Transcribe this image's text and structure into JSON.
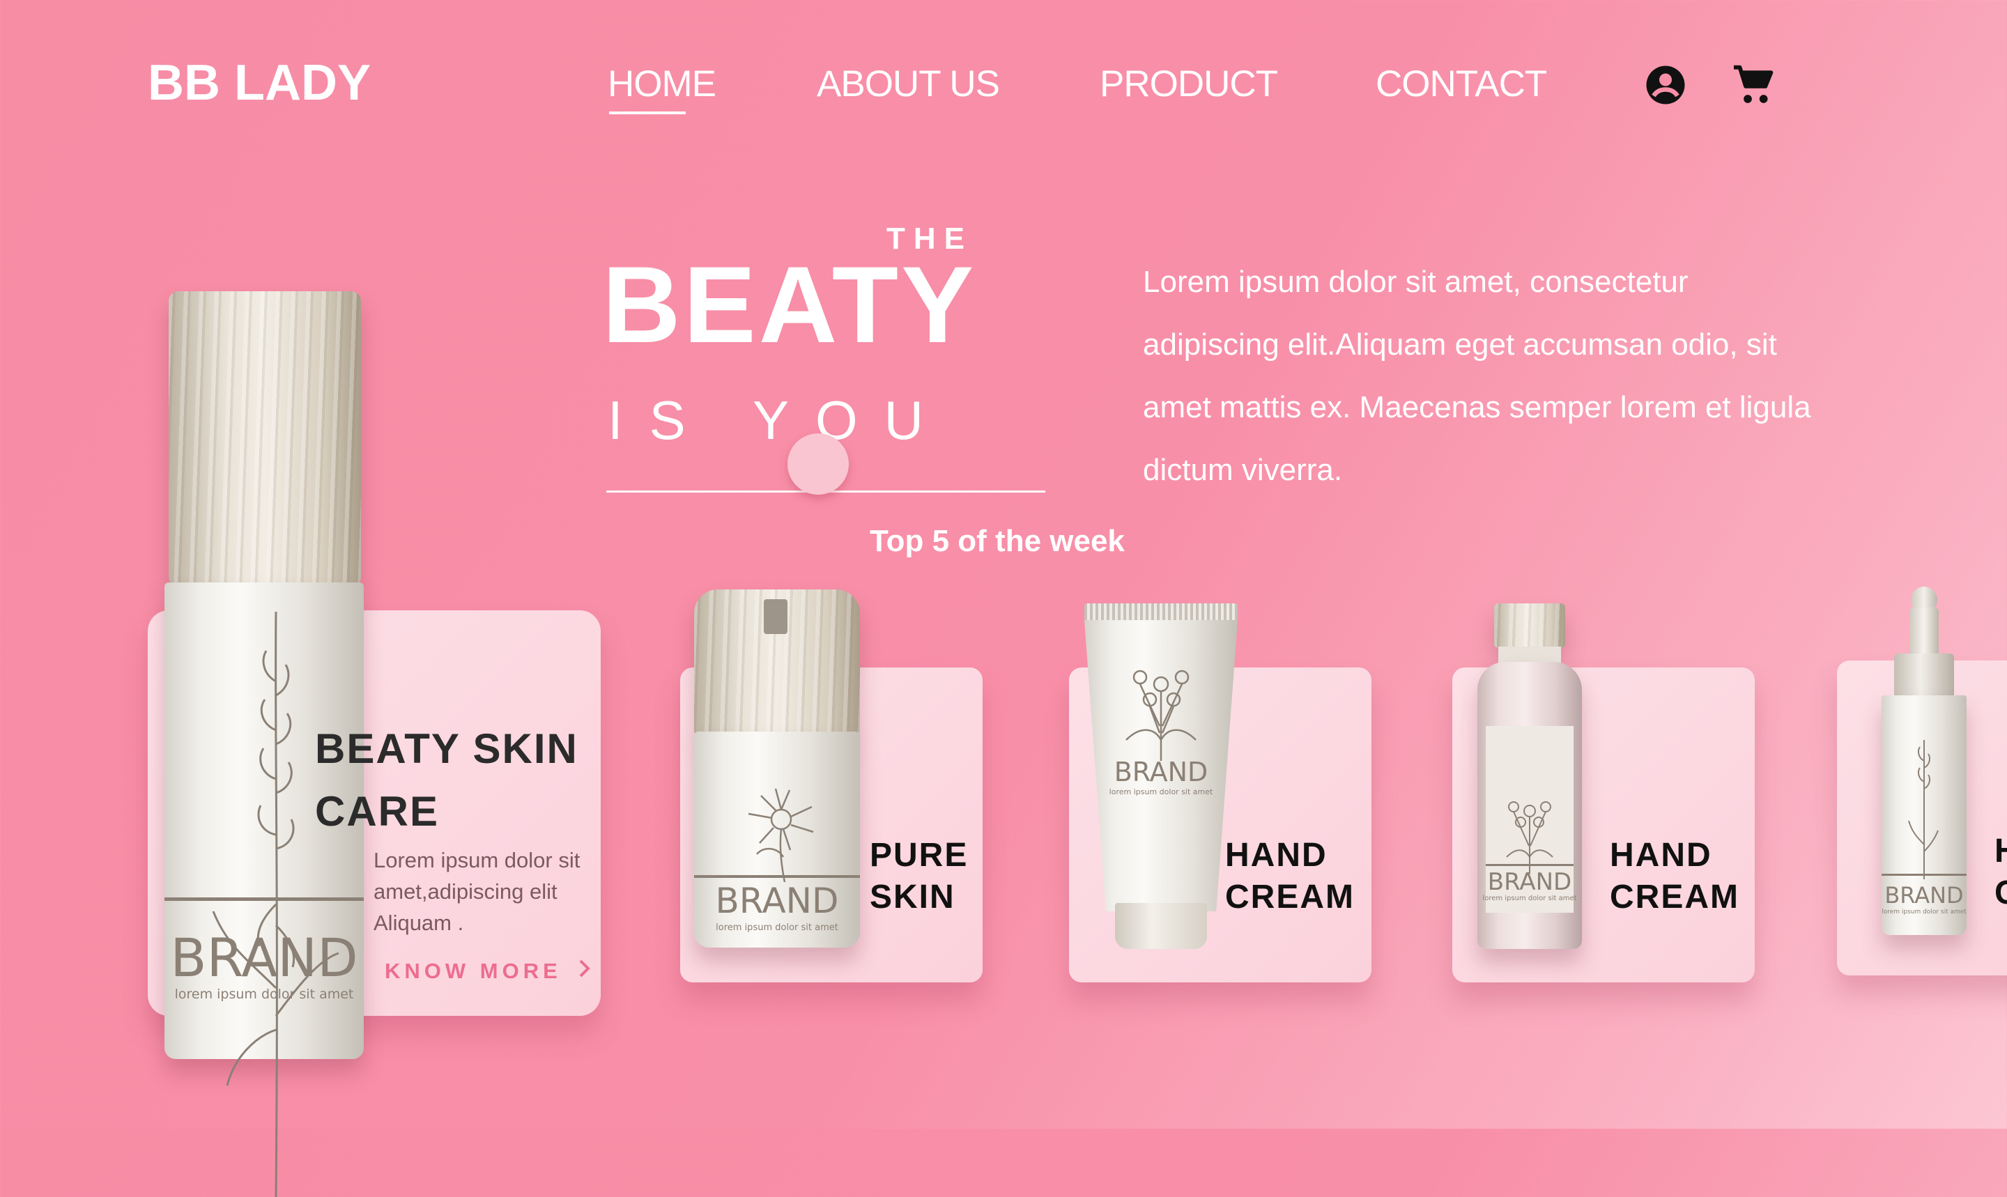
{
  "brand": {
    "logo": "BB LADY"
  },
  "nav": {
    "items": [
      {
        "label": "HOME",
        "active": true
      },
      {
        "label": "ABOUT US"
      },
      {
        "label": "PRODUCT"
      },
      {
        "label": "CONTACT"
      }
    ],
    "icons": [
      "account-circle-icon",
      "shopping-cart-icon"
    ]
  },
  "hero": {
    "the": "THE",
    "headline": "BEATY",
    "subline": "IS YOU",
    "intro": "Lorem ipsum dolor sit amet, consectetur adipiscing elit.Aliquam eget accumsan odio, sit amet mattis ex. Maecenas semper lorem et ligula dictum viverra."
  },
  "section": {
    "title": "Top 5 of the week"
  },
  "feature": {
    "title": "BEATY SKIN CARE",
    "description": "Lorem ipsum dolor sit amet,adipiscing elit Aliquam .",
    "cta": "KNOW MORE",
    "cta_icon": "chevron-right-icon",
    "bottle_brand": "BRAND",
    "bottle_sub": "lorem ipsum dolor sit amet"
  },
  "products": [
    {
      "line1": "PURE",
      "line2": "SKIN",
      "brand": "BRAND",
      "sub": "lorem ipsum dolor sit amet"
    },
    {
      "line1": "HAND",
      "line2": "CREAM",
      "brand": "BRAND",
      "sub": "lorem ipsum dolor sit amet"
    },
    {
      "line1": "HAND",
      "line2": "CREAM",
      "brand": "BRAND",
      "sub": "lorem ipsum dolor sit amet"
    },
    {
      "line1": "H",
      "line2": "C",
      "brand": "BRAND",
      "sub": "lorem ipsum dolor sit amet"
    }
  ],
  "colors": {
    "background": "#f88fa8",
    "card": "#fde0e7",
    "accent": "#ec6d8e",
    "text_dark": "#2b2b2b"
  }
}
